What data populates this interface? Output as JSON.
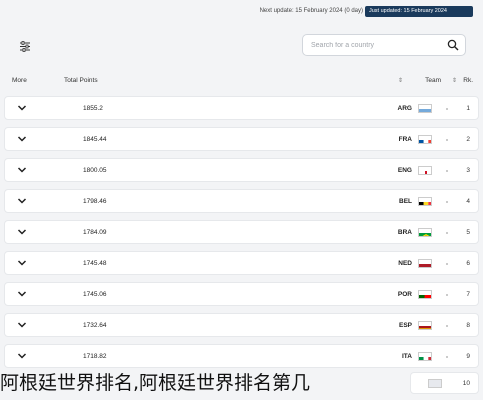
{
  "topbar": {
    "next_update": "Next update: 15 February 2024 (0 day)",
    "badge": "Just updated: 15 February 2024"
  },
  "search": {
    "placeholder": "Search for a country"
  },
  "table": {
    "headers": {
      "more": "More",
      "total_points": "Total Points",
      "team": "Team",
      "rank": "Rk.",
      "sort_glyph": "⇕"
    },
    "rows": [
      {
        "rank": "1",
        "code": "ARG",
        "points": "1855.2",
        "flag": "arg"
      },
      {
        "rank": "2",
        "code": "FRA",
        "points": "1845.44",
        "flag": "fra"
      },
      {
        "rank": "3",
        "code": "ENG",
        "points": "1800.05",
        "flag": "eng"
      },
      {
        "rank": "4",
        "code": "BEL",
        "points": "1798.46",
        "flag": "bel"
      },
      {
        "rank": "5",
        "code": "BRA",
        "points": "1784.09",
        "flag": "bra"
      },
      {
        "rank": "6",
        "code": "NED",
        "points": "1745.48",
        "flag": "ned"
      },
      {
        "rank": "7",
        "code": "POR",
        "points": "1745.06",
        "flag": "por"
      },
      {
        "rank": "8",
        "code": "ESP",
        "points": "1732.64",
        "flag": "esp"
      },
      {
        "rank": "9",
        "code": "ITA",
        "points": "1718.82",
        "flag": "ita"
      }
    ],
    "partial_row": {
      "rank": "10"
    }
  },
  "caption": "阿根廷世界排名,阿根廷世界排名第几",
  "colors": {
    "badge_bg": "#1a3a5c",
    "row_bg": "#ffffff",
    "page_bg": "#f3f4f6"
  },
  "icons": [
    "filter-icon",
    "search-icon",
    "chevron-down-icon",
    "flag-icon"
  ]
}
